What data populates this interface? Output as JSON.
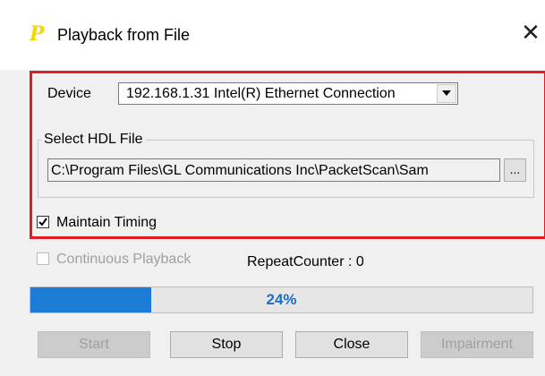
{
  "window": {
    "title": "Playback from File",
    "icon": "p-letter-icon",
    "close_glyph": "✕"
  },
  "device": {
    "label": "Device",
    "selected": "192.168.1.31  Intel(R) Ethernet Connection"
  },
  "hdl_file": {
    "group_title": "Select HDL File",
    "path": "C:\\Program Files\\GL Communications Inc\\PacketScan\\Sam",
    "browse_label": "..."
  },
  "options": {
    "maintain_timing": {
      "label": "Maintain Timing",
      "checked": true
    },
    "continuous_playback": {
      "label": "Continuous Playback",
      "checked": false,
      "enabled": false
    },
    "repeat_counter": "RepeatCounter : 0"
  },
  "progress": {
    "percent": 24,
    "label": "24%"
  },
  "buttons": {
    "start": "Start",
    "stop": "Stop",
    "close": "Close",
    "impairment": "Impairment"
  },
  "colors": {
    "highlight_border": "#e31c23",
    "progress_fill": "#1c7cd5",
    "icon": "#f5d800"
  }
}
